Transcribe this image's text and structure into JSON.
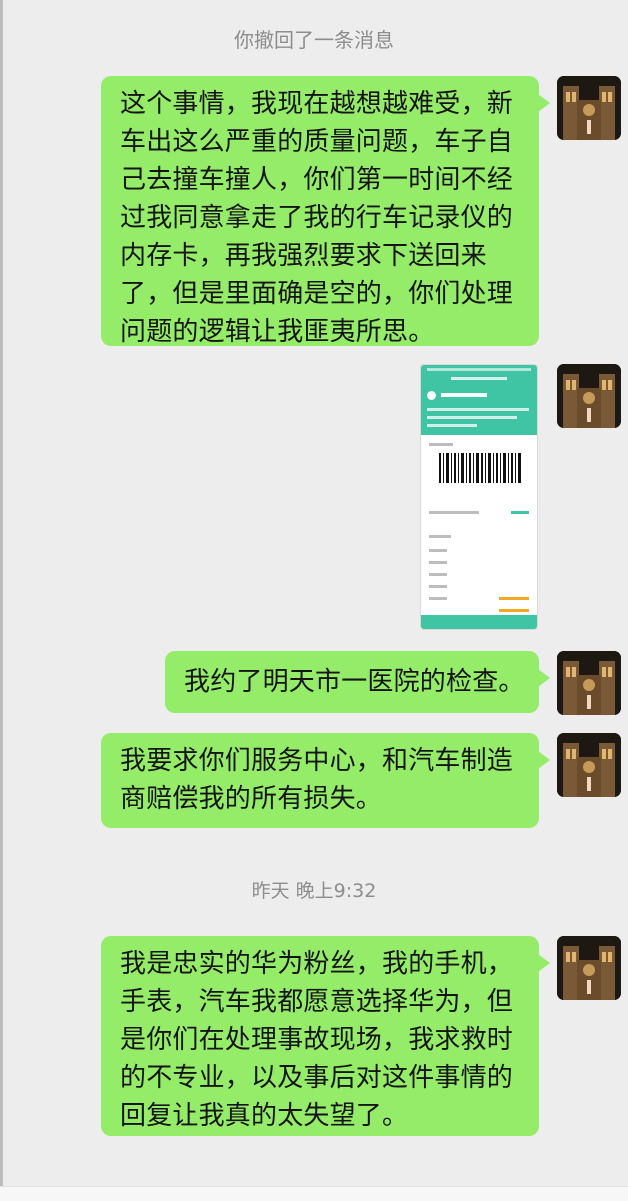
{
  "chat": {
    "recall_notice": "你撤回了一条消息",
    "timestamp": "昨天 晚上9:32",
    "messages": [
      {
        "lines": [
          "这个事情，我现在越想越难受，新",
          "车出这么严重的质量问题，车子自",
          "己去撞车撞人，你们第一时间不经",
          "过我同意拿走了我的行车记录仪的",
          "内存卡，再我强烈要求下送回来",
          "了，但是里面确是空的，你们处理",
          "问题的逻辑让我匪夷所思。"
        ]
      },
      {
        "lines": [
          "我约了明天市一医院的检查。"
        ]
      },
      {
        "lines": [
          "我要求你们服务中心，和汽车制造",
          "商赔偿我的所有损失。"
        ]
      },
      {
        "lines": [
          "我是忠实的华为粉丝，我的手机，",
          "手表，汽车我都愿意选择华为，但",
          "是你们在处理事故现场，我求救时",
          "的不专业，以及事后对这件事情的",
          "回复让我真的太失望了。"
        ]
      }
    ],
    "image_message": {
      "icon": "phone-screenshot-icon"
    },
    "colors": {
      "bubble": "#95ec69",
      "background": "#ededed",
      "accent": "#3fc4a4"
    },
    "avatar_icon": "cathedral-night-avatar-icon"
  }
}
